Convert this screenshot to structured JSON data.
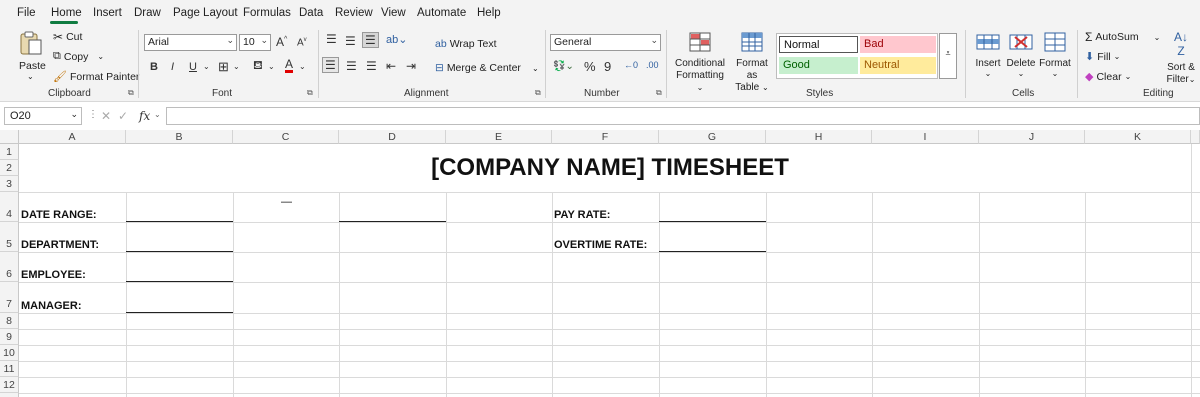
{
  "menu": {
    "items": [
      "File",
      "Home",
      "Insert",
      "Draw",
      "Page Layout",
      "Formulas",
      "Data",
      "Review",
      "View",
      "Automate",
      "Help"
    ]
  },
  "ribbon": {
    "clipboard": {
      "paste": "Paste",
      "cut": "Cut",
      "copy": "Copy",
      "format_painter": "Format Painter",
      "label": "Clipboard"
    },
    "font": {
      "family": "Arial",
      "size": "10",
      "label": "Font",
      "bold": "B",
      "italic": "I",
      "underline": "U"
    },
    "alignment": {
      "wrap_text": "Wrap Text",
      "merge_center": "Merge & Center",
      "label": "Alignment"
    },
    "number": {
      "format": "General",
      "label": "Number"
    },
    "styles": {
      "conditional": "Conditional Formatting",
      "conditional_l1": "Conditional",
      "conditional_l2": "Formatting",
      "format_table_l1": "Format as",
      "format_table_l2": "Table",
      "normal": "Normal",
      "bad": "Bad",
      "good": "Good",
      "neutral": "Neutral",
      "label": "Styles",
      "colors": {
        "bad_bg": "#ffc7ce",
        "bad_fg": "#9c0006",
        "good_bg": "#c6efce",
        "good_fg": "#006100",
        "neutral_bg": "#ffeb9c",
        "neutral_fg": "#9c5700"
      }
    },
    "cells": {
      "insert": "Insert",
      "delete": "Delete",
      "format": "Format",
      "label": "Cells"
    },
    "editing": {
      "autosum": "AutoSum",
      "fill": "Fill",
      "clear": "Clear",
      "sort_l1": "Sort &",
      "sort_l2": "Filter",
      "label": "Editing"
    }
  },
  "formula_bar": {
    "name_box": "O20",
    "fx": "fx",
    "value": ""
  },
  "grid": {
    "columns": [
      "A",
      "B",
      "C",
      "D",
      "E",
      "F",
      "G",
      "H",
      "I",
      "J",
      "K"
    ],
    "rows": [
      "1",
      "2",
      "3",
      "4",
      "5",
      "6",
      "7",
      "8",
      "9",
      "10",
      "11",
      "12"
    ],
    "title": "[COMPANY NAME] TIMESHEET",
    "labels": {
      "date_range": "DATE RANGE:",
      "department": "DEPARTMENT:",
      "employee": "EMPLOYEE:",
      "manager": "MANAGER:",
      "pay_rate": "PAY RATE:",
      "overtime_rate": "OVERTIME RATE:",
      "dash": "—"
    }
  },
  "accent": "#107c41"
}
